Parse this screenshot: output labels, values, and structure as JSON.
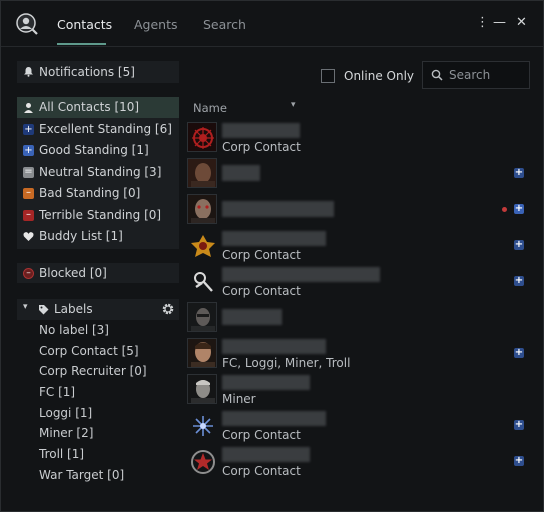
{
  "tabs": [
    {
      "label": "Contacts"
    },
    {
      "label": "Agents"
    },
    {
      "label": "Search"
    }
  ],
  "window_controls": {
    "menu": "⋮",
    "minimize": "—",
    "close": "✕"
  },
  "notifications": {
    "label": "Notifications [5]"
  },
  "filters": [
    {
      "label": "All Contacts [10]",
      "icon": "person-icon",
      "color": "#e6e6e6",
      "selected": true
    },
    {
      "label": "Excellent Standing [6]",
      "icon": "plus-icon",
      "color": "#1f3a7a"
    },
    {
      "label": "Good Standing [1]",
      "icon": "plus-icon",
      "color": "#3a63b7"
    },
    {
      "label": "Neutral Standing [3]",
      "icon": "equal-icon",
      "color": "#8a8d90"
    },
    {
      "label": "Bad Standing [0]",
      "icon": "minus-icon",
      "color": "#c86a24"
    },
    {
      "label": "Terrible Standing [0]",
      "icon": "minus-icon",
      "color": "#a52626"
    },
    {
      "label": "Buddy List [1]",
      "icon": "heart-icon",
      "color": "#e6e6e6"
    }
  ],
  "blocked": {
    "label": "Blocked [0]"
  },
  "labels_section": {
    "title": "Labels",
    "items": [
      "No label [3]",
      "Corp Contact [5]",
      "Corp Recruiter [0]",
      "FC [1]",
      "Loggi [1]",
      "Miner [2]",
      "Troll [1]",
      "War Target [0]"
    ]
  },
  "online_only": {
    "label": "Online Only",
    "checked": false
  },
  "search": {
    "placeholder": "Search"
  },
  "list_header": {
    "name": "Name",
    "sort_icon": "▾"
  },
  "contacts": [
    {
      "subtext": "Corp Contact",
      "standing": null,
      "online": false
    },
    {
      "subtext": "",
      "standing": "excellent",
      "online": false
    },
    {
      "subtext": "",
      "standing": "good",
      "online": true
    },
    {
      "subtext": "Corp Contact",
      "standing": "excellent",
      "online": false
    },
    {
      "subtext": "Corp Contact",
      "standing": "excellent",
      "online": false
    },
    {
      "subtext": "",
      "standing": null,
      "online": false
    },
    {
      "subtext": "FC, Loggi, Miner, Troll",
      "standing": "excellent",
      "online": false
    },
    {
      "subtext": "Miner",
      "standing": null,
      "online": false
    },
    {
      "subtext": "Corp Contact",
      "standing": "excellent",
      "online": false
    },
    {
      "subtext": "Corp Contact",
      "standing": "excellent",
      "online": false
    }
  ]
}
